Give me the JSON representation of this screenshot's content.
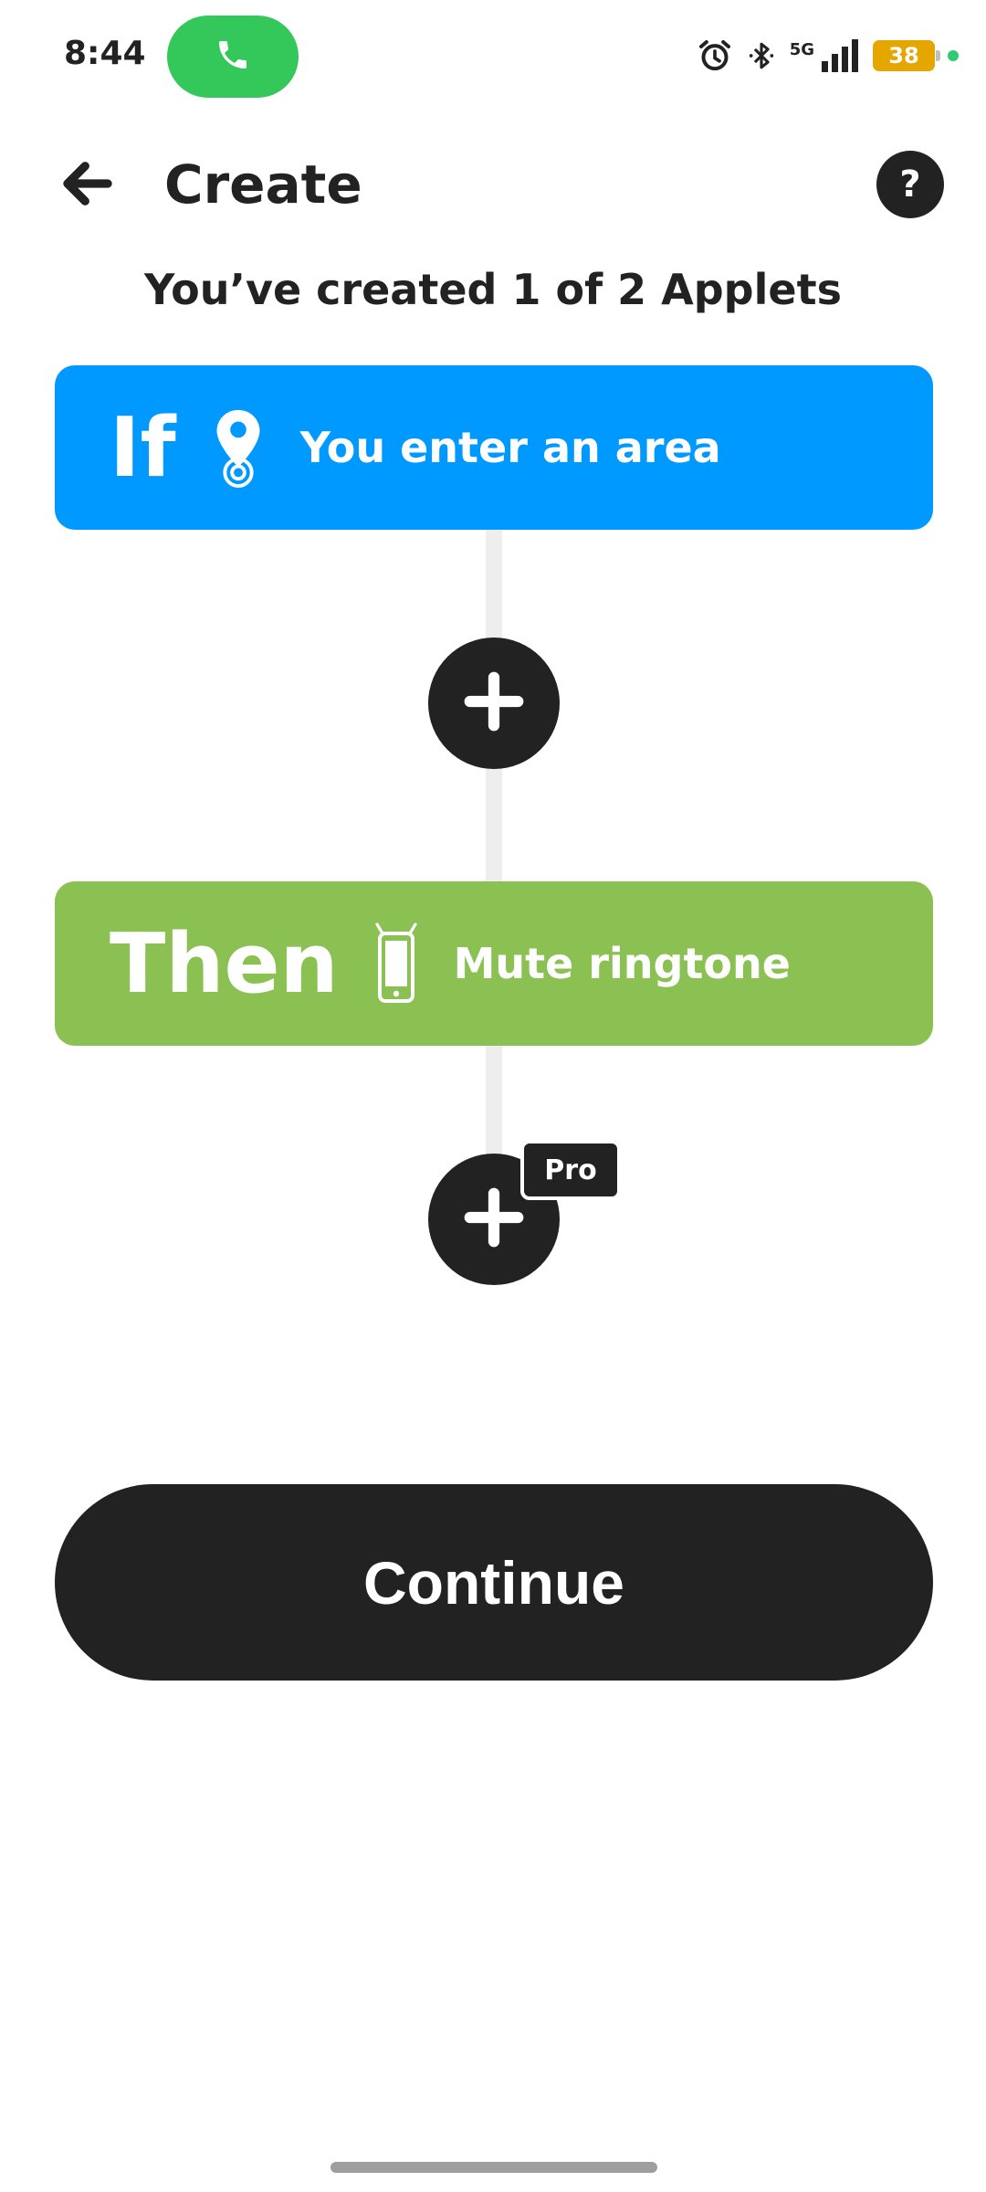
{
  "status_bar": {
    "time": "8:44",
    "network": "5G",
    "battery": "38"
  },
  "header": {
    "title": "Create",
    "help": "?"
  },
  "applet_count": "You’ve created 1 of 2 Applets",
  "if_card": {
    "keyword": "If",
    "label": "You enter an area",
    "icon": "location-pin-icon",
    "color": "#0099ff"
  },
  "then_card": {
    "keyword": "Then",
    "label": "Mute ringtone",
    "icon": "android-phone-icon",
    "color": "#8bc152"
  },
  "pro_badge": "Pro",
  "continue_label": "Continue",
  "colors": {
    "dark": "#222222",
    "call": "#34c759",
    "battery": "#e6a600"
  }
}
